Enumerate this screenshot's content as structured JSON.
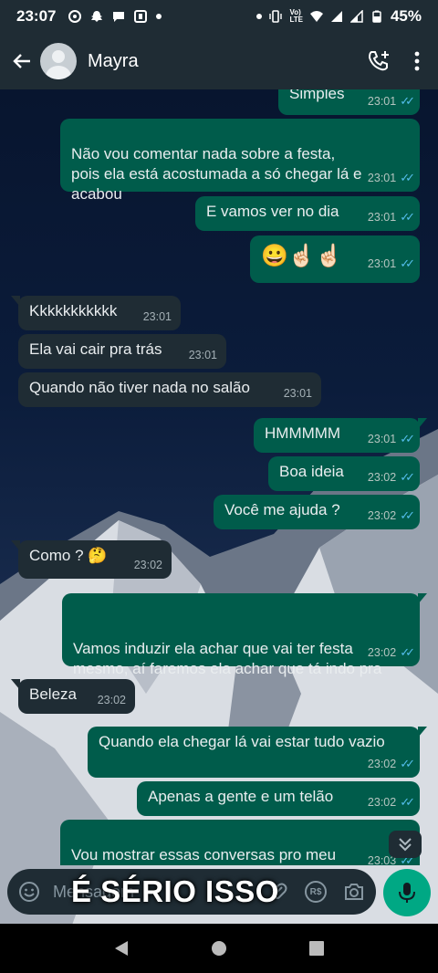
{
  "status_bar": {
    "time": "23:07",
    "battery": "45%"
  },
  "header": {
    "contact_name": "Mayra",
    "icons": [
      "back-arrow-icon",
      "add-call-icon",
      "more-vert-icon"
    ]
  },
  "messages": [
    {
      "dir": "out",
      "text": "Simples",
      "time": "23:01"
    },
    {
      "dir": "out",
      "text": "Não vou comentar nada sobre a festa,\npois ela está acostumada a só chegar lá e\nacabou",
      "time": "23:01"
    },
    {
      "dir": "out",
      "text": "E vamos ver no dia",
      "time": "23:01"
    },
    {
      "dir": "out",
      "text": "😀☝🏻☝🏻",
      "time": "23:01"
    },
    {
      "dir": "in",
      "text": "Kkkkkkkkkkk",
      "time": "23:01"
    },
    {
      "dir": "in",
      "text": "Ela vai cair pra trás",
      "time": "23:01"
    },
    {
      "dir": "in",
      "text": "Quando não tiver nada no salão",
      "time": "23:01"
    },
    {
      "dir": "out",
      "text": "HMMMMM",
      "time": "23:01"
    },
    {
      "dir": "out",
      "text": "Boa ideia",
      "time": "23:02"
    },
    {
      "dir": "out",
      "text": "Você me ajuda ?",
      "time": "23:02"
    },
    {
      "dir": "in",
      "text": "Como ? 🤔",
      "time": "23:02"
    },
    {
      "dir": "out",
      "text": "Vamos induzir ela achar que vai ter festa\nmesmo, aí faremos ela achar que tá indo pra\nfesta",
      "time": "23:02"
    },
    {
      "dir": "in",
      "text": "Beleza",
      "time": "23:02"
    },
    {
      "dir": "out",
      "text": "Quando ela chegar lá vai estar tudo vazio",
      "time": "23:02"
    },
    {
      "dir": "out",
      "text": "Apenas a gente e um telão",
      "time": "23:02"
    },
    {
      "dir": "out",
      "text": "Vou mostrar essas conversas pro meu\nmarido",
      "time": "23:03"
    }
  ],
  "input": {
    "placeholder": "Mensagem",
    "currency_icon_label": "R$"
  },
  "overlay_caption": "É SÉRIO ISSO",
  "colors": {
    "outgoing_bubble": "#005c4b",
    "incoming_bubble": "#1f2c34",
    "header": "#1f2c34",
    "read_ticks": "#53bdeb",
    "mic_button": "#00a884"
  }
}
